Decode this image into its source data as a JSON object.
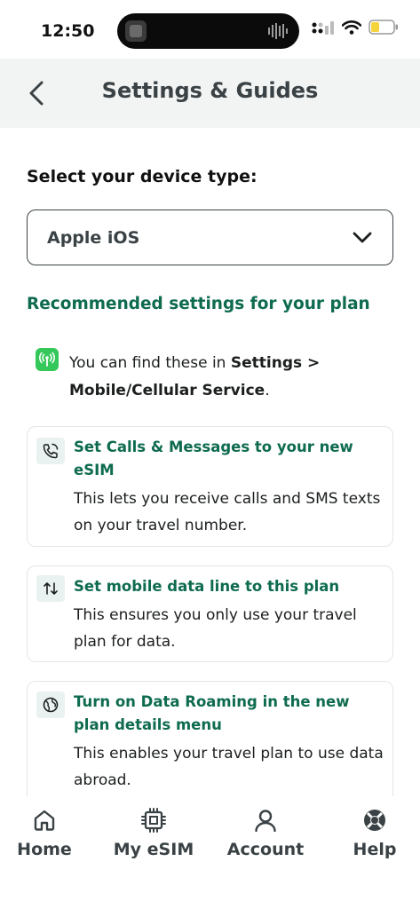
{
  "status_bar": {
    "time": "12:50"
  },
  "header": {
    "title": "Settings & Guides"
  },
  "device": {
    "label": "Select your device type:",
    "selected": "Apple iOS"
  },
  "section": {
    "heading": "Recommended settings for your plan"
  },
  "hint": {
    "prefix": "You can find these in ",
    "path": "Settings > Mobile/Cellular Service",
    "suffix": "."
  },
  "cards": [
    {
      "icon": "phone-sms-icon",
      "title": "Set Calls & Messages to your new eSIM",
      "description": "This lets you receive calls and SMS texts on your travel number."
    },
    {
      "icon": "data-arrows-icon",
      "title": "Set mobile data line to this plan",
      "description": "This ensures you only use your travel plan for data."
    },
    {
      "icon": "globe-roaming-icon",
      "title": "Turn on Data Roaming in the new plan details menu",
      "description": "This enables your travel plan to use data abroad."
    }
  ],
  "nav": {
    "items": [
      {
        "label": "Home",
        "icon": "home-icon"
      },
      {
        "label": "My eSIM",
        "icon": "chip-icon"
      },
      {
        "label": "Account",
        "icon": "user-icon"
      },
      {
        "label": "Help",
        "icon": "lifebuoy-icon"
      }
    ]
  },
  "colors": {
    "accent": "#0e6b4f",
    "heading": "#3a4245",
    "hint_icon_bg": "#34c759",
    "battery": "#f5d33c"
  }
}
